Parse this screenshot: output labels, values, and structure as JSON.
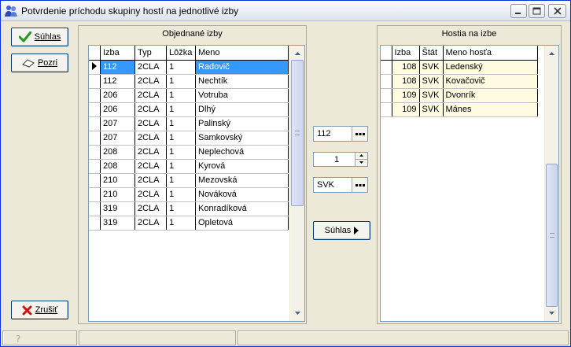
{
  "window": {
    "title": "Potvrdenie príchodu skupiny hostí na jednotlivé izby"
  },
  "left_buttons": {
    "confirm_label": "Súhlas",
    "view_label": "Pozri",
    "cancel_label": "Zrušiť"
  },
  "rooms_panel": {
    "title": "Objednané izby",
    "columns": [
      "Izba",
      "Typ",
      "Lôžka",
      "Meno"
    ],
    "rows": [
      [
        "112",
        "2CLA",
        "1",
        "Radovič"
      ],
      [
        "112",
        "2CLA",
        "1",
        "Nechtík"
      ],
      [
        "206",
        "2CLA",
        "1",
        "Votruba"
      ],
      [
        "206",
        "2CLA",
        "1",
        "Dlhý"
      ],
      [
        "207",
        "2CLA",
        "1",
        "Palinský"
      ],
      [
        "207",
        "2CLA",
        "1",
        "Samkovský"
      ],
      [
        "208",
        "2CLA",
        "1",
        "Neplechová"
      ],
      [
        "208",
        "2CLA",
        "1",
        "Kyrová"
      ],
      [
        "210",
        "2CLA",
        "1",
        "Mezovská"
      ],
      [
        "210",
        "2CLA",
        "1",
        "Nováková"
      ],
      [
        "319",
        "2CLA",
        "1",
        "Konradíková"
      ],
      [
        "319",
        "2CLA",
        "1",
        "Opletová"
      ]
    ]
  },
  "middle": {
    "room_value": "112",
    "count_value": "1",
    "country_value": "SVK",
    "assign_label": "Súhlas"
  },
  "guests_panel": {
    "title": "Hostia na izbe",
    "columns": [
      "Izba",
      "Štát",
      "Meno hosťa"
    ],
    "rows": [
      [
        "108",
        "SVK",
        "Ledenský"
      ],
      [
        "108",
        "SVK",
        "Kovačovič"
      ],
      [
        "109",
        "SVK",
        "Dvonrík"
      ],
      [
        "109",
        "SVK",
        "Mánes"
      ]
    ]
  },
  "colors": {
    "selection": "#3399ff",
    "guest_row_bg": "#fffbe1",
    "confirm_check": "#1f9a1f",
    "cancel_x": "#d01010"
  }
}
